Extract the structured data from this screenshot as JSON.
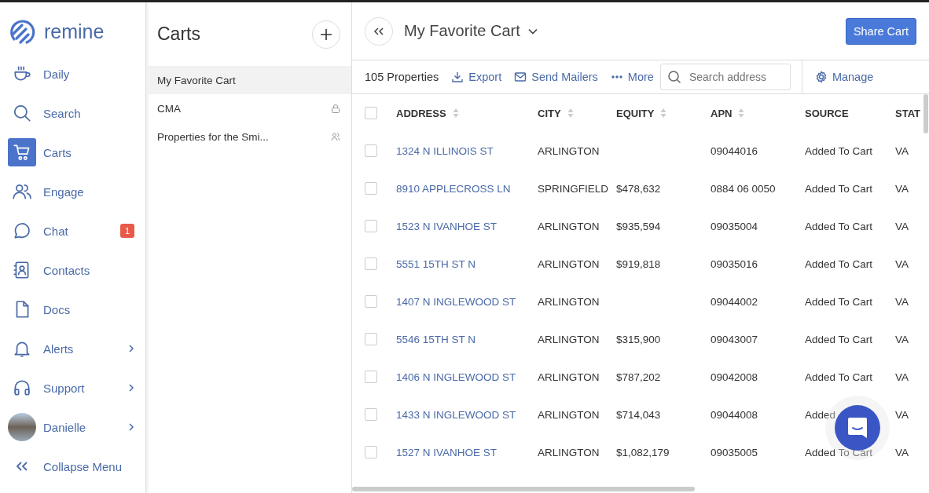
{
  "brand": "remine",
  "nav": [
    {
      "label": "Daily",
      "selected": false
    },
    {
      "label": "Search",
      "selected": false
    },
    {
      "label": "Carts",
      "selected": true
    },
    {
      "label": "Engage",
      "selected": false
    },
    {
      "label": "Chat",
      "selected": false,
      "badge": "1"
    },
    {
      "label": "Contacts",
      "selected": false
    },
    {
      "label": "Docs",
      "selected": false
    },
    {
      "label": "Alerts",
      "selected": false,
      "expandable": true
    },
    {
      "label": "Support",
      "selected": false,
      "expandable": true
    },
    {
      "label": "Danielle",
      "selected": false,
      "expandable": true
    }
  ],
  "collapse_label": "Collapse Menu",
  "carts_panel": {
    "title": "Carts",
    "items": [
      {
        "label": "My Favorite Cart",
        "selected": true,
        "kind": "plain"
      },
      {
        "label": "CMA",
        "selected": false,
        "kind": "locked"
      },
      {
        "label": "Properties for the Smi...",
        "selected": false,
        "kind": "shared"
      }
    ]
  },
  "header": {
    "title": "My Favorite Cart",
    "share_button": "Share Cart"
  },
  "toolbar": {
    "count": "105 Properties",
    "actions": [
      "Export",
      "Send Mailers",
      "More"
    ],
    "search": {
      "placeholder": "Search address"
    },
    "manage": "Manage"
  },
  "table": {
    "all_selected": false,
    "columns": [
      {
        "label": "ADDRESS",
        "sortable": true
      },
      {
        "label": "CITY",
        "sortable": true
      },
      {
        "label": "EQUITY",
        "sortable": true
      },
      {
        "label": "APN",
        "sortable": true
      },
      {
        "label": "SOURCE",
        "sortable": false
      },
      {
        "label": "STAT",
        "sortable": false
      }
    ],
    "rows": [
      {
        "checked": false,
        "cells": [
          "1324 N ILLINOIS ST",
          "ARLINGTON",
          null,
          "09044016",
          "Added To Cart",
          "VA"
        ]
      },
      {
        "checked": false,
        "cells": [
          "8910 APPLECROSS LN",
          "SPRINGFIELD",
          "$478,632",
          "0884 06 0050",
          "Added To Cart",
          "VA"
        ]
      },
      {
        "checked": false,
        "cells": [
          "1523 N IVANHOE ST",
          "ARLINGTON",
          "$935,594",
          "09035004",
          "Added To Cart",
          "VA"
        ]
      },
      {
        "checked": false,
        "cells": [
          "5551 15TH ST N",
          "ARLINGTON",
          "$919,818",
          "09035016",
          "Added To Cart",
          "VA"
        ]
      },
      {
        "checked": false,
        "cells": [
          "1407 N INGLEWOOD ST",
          "ARLINGTON",
          null,
          "09044002",
          "Added To Cart",
          "VA"
        ]
      },
      {
        "checked": false,
        "cells": [
          "5546 15TH ST N",
          "ARLINGTON",
          "$315,900",
          "09043007",
          "Added To Cart",
          "VA"
        ]
      },
      {
        "checked": false,
        "cells": [
          "1406 N INGLEWOOD ST",
          "ARLINGTON",
          "$787,202",
          "09042008",
          "Added To Cart",
          "VA"
        ]
      },
      {
        "checked": false,
        "cells": [
          "1433 N INGLEWOOD ST",
          "ARLINGTON",
          "$714,043",
          "09044008",
          "Added",
          "VA"
        ]
      },
      {
        "checked": false,
        "cells": [
          "1527 N IVANHOE ST",
          "ARLINGTON",
          "$1,082,179",
          "09035005",
          "Added To Cart",
          "VA"
        ]
      }
    ]
  }
}
